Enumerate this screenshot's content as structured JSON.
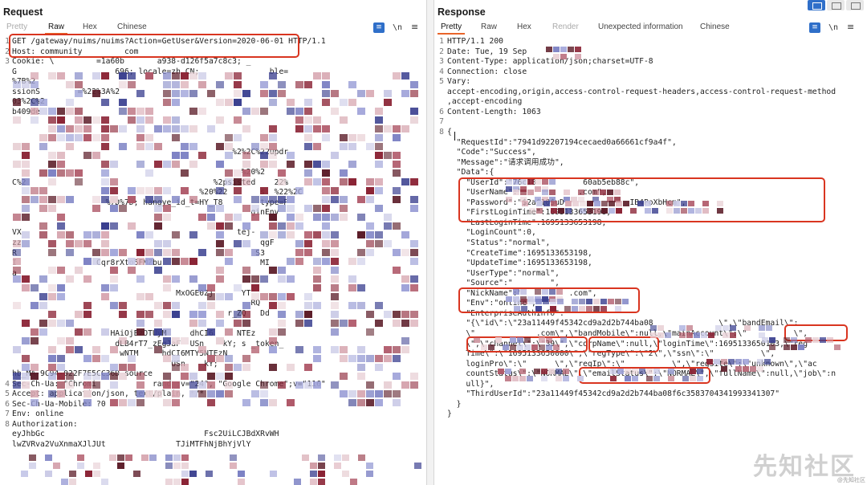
{
  "request": {
    "title": "Request",
    "tabs": [
      "Pretty",
      "Raw",
      "Hex",
      "Chinese"
    ],
    "active_tab": "Raw",
    "toolbar": {
      "newline_label": "\\n",
      "menu_glyph": "≡"
    },
    "lines": [
      {
        "n": "1",
        "t": "GET /gateway/nuims/nuims?Action=GetUser&Version=2020-06-01 HTTP/1.1"
      },
      {
        "n": "2",
        "t": "Host: community         com"
      },
      {
        "n": "3",
        "t": "Cookie: \\         =1a60b       a938-d126f5a7c8c3; _  "
      },
      {
        "n": "",
        "t": "G                     696; locale=zh_CN;               ble="
      },
      {
        "n": "",
        "t": "%7B%2                                                       "
      },
      {
        "n": "",
        "t": "ssionS        =%22%3A%2                                      "
      },
      {
        "n": "",
        "t": "03%2C%2                                                      "
      },
      {
        "n": "",
        "t": "b409de                                                       "
      },
      {
        "n": "",
        "t": ""
      },
      {
        "n": "",
        "t": ""
      },
      {
        "n": "",
        "t": ""
      },
      {
        "n": "",
        "t": "                                               %2%2C%22updr"
      },
      {
        "n": "",
        "t": ""
      },
      {
        "n": "",
        "t": "                                                 %20%2      "
      },
      {
        "n": "",
        "t": "C%2                                        %2psisted    22%"
      },
      {
        "n": "",
        "t": "                                        %20%22       s  %22%2C"
      },
      {
        "n": "",
        "t": "                    %7D%7D; hangye_id_t=HY_T8        type=P"
      },
      {
        "n": "",
        "t": "                                                   ginEnv"
      },
      {
        "n": "",
        "t": ""
      },
      {
        "n": "",
        "t": "VX                                              tej-"
      },
      {
        "n": "",
        "t": "zz                                                   qgF"
      },
      {
        "n": "",
        "t": "R                                                   S3"
      },
      {
        "n": "",
        "t": "I                 Cqr8rXto5FMZbu                     MI"
      },
      {
        "n": "",
        "t": "a                                                    "
      },
      {
        "n": "",
        "t": ""
      },
      {
        "n": "",
        "t": "                                   MxOGE0Zj      YT"
      },
      {
        "n": "",
        "t": "                                                   RQ"
      },
      {
        "n": "",
        "t": "                                              r_ZQ   Dd"
      },
      {
        "n": "",
        "t": ""
      },
      {
        "n": "",
        "t": "                     HAiOjEzOTUyM     dhCI6     NTEz"
      },
      {
        "n": "",
        "t": "                      dLB4rT7_zEgJaF  USn    kY; s _token_"
      },
      {
        "n": "",
        "t": "                       wNTM     hdCI6MTY5NTEzN"
      },
      {
        "n": "",
        "t": "                                  USn    kY;"
      },
      {
        "n": "",
        "t": "hb_MA-9C94-022F7E5CC36D source"
      },
      {
        "n": "4",
        "t": "Sec-Ch-Ua: \"Chromi            rand ;v=\"24\", \"Google Chrome\";v=\"116\""
      },
      {
        "n": "5",
        "t": "Accept: application/json, text/plain, */*"
      },
      {
        "n": "6",
        "t": "Sec-Ch-Ua-Mobile: ?0"
      },
      {
        "n": "7",
        "t": "Env: online"
      },
      {
        "n": "8",
        "t": "Authorization:"
      },
      {
        "n": "",
        "t": "eyJhbGc                                  Fsc2UiLCJBdXRvWH"
      },
      {
        "n": "",
        "t": "lwZVRva2VuXnmaXJlJUt               TJiMTFhNjBhYjVlY"
      }
    ]
  },
  "response": {
    "title": "Response",
    "tabs": [
      "Pretty",
      "Raw",
      "Hex",
      "Render",
      "Unexpected information",
      "Chinese"
    ],
    "active_tab": "Pretty",
    "toolbar": {
      "newline_label": "\\n",
      "menu_glyph": "≡"
    },
    "lines": [
      {
        "n": "1",
        "t": "HTTP/1.1 200"
      },
      {
        "n": "2",
        "t": "Date: Tue, 19 Sep"
      },
      {
        "n": "3",
        "t": "Content-Type: application/json;charset=UTF-8"
      },
      {
        "n": "4",
        "t": "Connection: close"
      },
      {
        "n": "5",
        "t": "Vary:"
      },
      {
        "n": "",
        "t": "accept-encoding,origin,access-control-request-headers,access-control-request-method"
      },
      {
        "n": "",
        "t": ",accept-encoding"
      },
      {
        "n": "6",
        "t": "Content-Length: 1063"
      },
      {
        "n": "7",
        "t": ""
      },
      {
        "n": "8",
        "t": "{"
      },
      {
        "n": "",
        "t": "  \"RequestId\":\"7941d92207194cecaed0a66661cf9a4f\","
      },
      {
        "n": "",
        "t": "  \"Code\":\"Success\","
      },
      {
        "n": "",
        "t": "  \"Message\":\"请求调用成功\","
      },
      {
        "n": "",
        "t": "  \"Data\":{"
      },
      {
        "n": "",
        "t": "    \"UserId\":\"76c18          60ab5eb88c\","
      },
      {
        "n": "",
        "t": "    \"UserName\":\"            .com\","
      },
      {
        "n": "",
        "t": "    \"Password\":\"$2a$10$uD              IB4PoXbHcm\","
      },
      {
        "n": "",
        "t": "    \"FirstLoginTime\":1695133653198,"
      },
      {
        "n": "",
        "t": "    \"LastLoginTime\":1695133653198,"
      },
      {
        "n": "",
        "t": "    \"LoginCount\":0,"
      },
      {
        "n": "",
        "t": "    \"Status\":\"normal\","
      },
      {
        "n": "",
        "t": "    \"CreateTime\":1695133653198,"
      },
      {
        "n": "",
        "t": "    \"UpdateTime\":1695133653198,"
      },
      {
        "n": "",
        "t": "    \"UserType\":\"normal\","
      },
      {
        "n": "",
        "t": "    \"Source\":\"        \","
      },
      {
        "n": "",
        "t": "    \"NickName\":\"          .com\","
      },
      {
        "n": "",
        "t": "    \"Env\":\"online\","
      },
      {
        "n": "",
        "t": "    \"EnterpriseAuthInfo\":"
      },
      {
        "n": "",
        "t": "    \"{\\\"id\\\":\\\"23a11449f45342cd9a2d2b744ba08              \\\",\\\"bandEmail\\\":"
      },
      {
        "n": "",
        "t": "    \\\"             .com\\\",\\\"bandMobile\\\":null,\\\"mainAccount\\\":\\\"          \\\","
      },
      {
        "n": "",
        "t": "    \\\",\\\"channel\\\":\\\"39\\\",\\\"corpName\\\":null,\\\"loginTime\\\":1695133650103,\\\"reg"
      },
      {
        "n": "",
        "t": "    Time\\\":\\\"1695133650000\\\",\\\"regType\\\":\\\"2\\\",\\\"ssn\\\":\\\"          \\\","
      },
      {
        "n": "",
        "t": "    loginPro\\\":\\\"      \\\",\\\"regIp\\\":\\\"          \\\",\\\"regSite\\\":\\\"unknown\\\",\\\"ac"
      },
      {
        "n": "",
        "t": "    countStatus\\\":\\\"NORMAL\\\",\\\"emailStatus\\\":\\\"NORMAL\\\",\\\"fullName\\\":null,\\\"job\\\":n"
      },
      {
        "n": "",
        "t": "    ull}\","
      },
      {
        "n": "",
        "t": "    \"ThirdUserId\":\"23a11449f45342cd9a2d2b744ba08f6c3583704341993341307\""
      },
      {
        "n": "",
        "t": "  }"
      },
      {
        "n": "",
        "t": "}"
      }
    ]
  },
  "watermark": {
    "text": "先知社区",
    "small": "@先知社区"
  },
  "colors": {
    "highlight": "#d93520",
    "accent": "#2f6fc9",
    "tab_underline": "#e8652a"
  }
}
